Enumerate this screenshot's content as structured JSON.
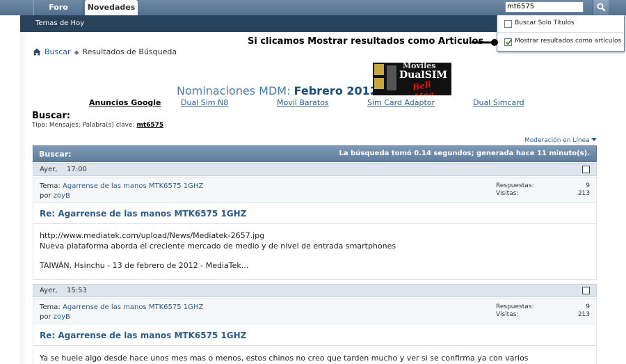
{
  "nav": {
    "tabs": [
      "Foro",
      "Novedades"
    ],
    "subnav_item": "Temas de Hoy",
    "search_value": "mt6575"
  },
  "dropdown": {
    "option1": "Buscar Solo Títulos",
    "option2": "Mostrar resultados como artículos",
    "option1_checked": false,
    "option2_checked": true
  },
  "annotation": "Si clicamos Mostrar resultados como Articulos",
  "breadcrumb": {
    "link": "Buscar",
    "current": "Resultados de Búsqueda"
  },
  "banner": {
    "title_prefix": "Nominaciones MDM:",
    "title_month": "Febrero 2012",
    "ad_text1": "Moviles",
    "ad_text2": "DualSIM",
    "ad_text3": "Bell Mea"
  },
  "ads": {
    "label": "Anuncios Google",
    "links": [
      "Dual Sim N8",
      "Movil Baratos",
      "Sim Card Adaptor",
      "Dual Simcard"
    ]
  },
  "search": {
    "heading": "Buscar:",
    "type_text": "Tipo: Mensajes; Palabra(s) clave:",
    "keyword": "mt6575",
    "moderation": "Moderación en Línea"
  },
  "results_bar": {
    "left": "Buscar:",
    "right": "La búsqueda tomó 0.14 segundos; generada hace 11 minuto(s)."
  },
  "posts": [
    {
      "date": "Ayer,",
      "time": "17:00",
      "tema_label": "Tema:",
      "tema": "Agarrense de las manos MTK6575 1GHZ",
      "por_label": "por",
      "author": "zoyB",
      "respuestas_label": "Respuestas:",
      "respuestas": "9",
      "visitas_label": "Visitas:",
      "visitas": "213",
      "title": "Re: Agarrense de las manos MTK6575 1GHZ",
      "body": [
        "http://www.mediatek.com/upload/News/Mediatek-2657.jpg",
        "Nueva plataforma aborda el creciente mercado de medio y de nivel de entrada smartphones",
        "TAIWÁN, Hsinchu - 13 de febrero de 2012 - MediaTek..."
      ]
    },
    {
      "date": "Ayer,",
      "time": "15:53",
      "tema_label": "Tema:",
      "tema": "Agarrense de las manos MTK6575 1GHZ",
      "por_label": "por",
      "author": "zoyB",
      "respuestas_label": "Respuestas:",
      "respuestas": "9",
      "visitas_label": "Visitas:",
      "visitas": "213",
      "title": "Re: Agarrense de las manos MTK6575 1GHZ",
      "body": [
        "Ya se huele algo desde hace unos mes mas o menos, estos chinos no creo que tarden mucho y ver si se confirma ya con varios"
      ]
    }
  ]
}
